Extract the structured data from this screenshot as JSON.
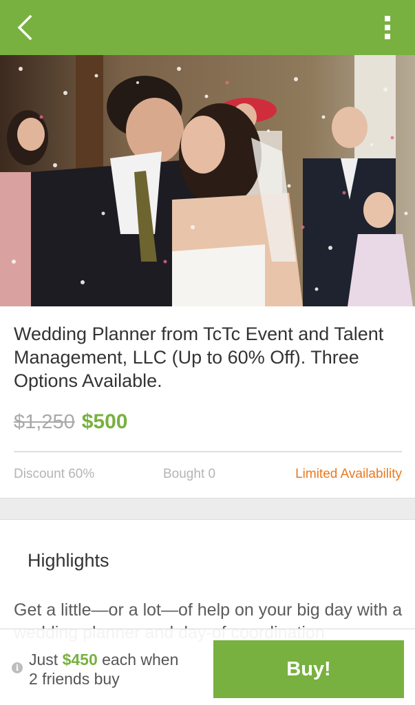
{
  "header": {
    "back_icon": "chevron-left-icon",
    "menu_icon": "overflow-menu-icon",
    "background_color": "#78b13f"
  },
  "deal": {
    "title": "Wedding Planner from TcTc Event and Talent Management, LLC (Up to 60% Off). Three Options Available.",
    "original_price": "$1,250",
    "price": "$500",
    "discount_label": "Discount 60%",
    "bought_label": "Bought 0",
    "availability_label": "Limited Availability"
  },
  "highlights": {
    "title": "Highlights",
    "text": "Get a little—or a lot—of help on your big day with a wedding planner and day-of coordination"
  },
  "footer": {
    "info_icon": "info-icon",
    "prefix": "Just ",
    "group_price": "$450",
    "suffix_line1": " each when",
    "line2": "2 friends buy",
    "buy_label": "Buy!"
  },
  "colors": {
    "accent": "#78b13f",
    "availability": "#e8791f",
    "muted": "#b4b4b4"
  }
}
